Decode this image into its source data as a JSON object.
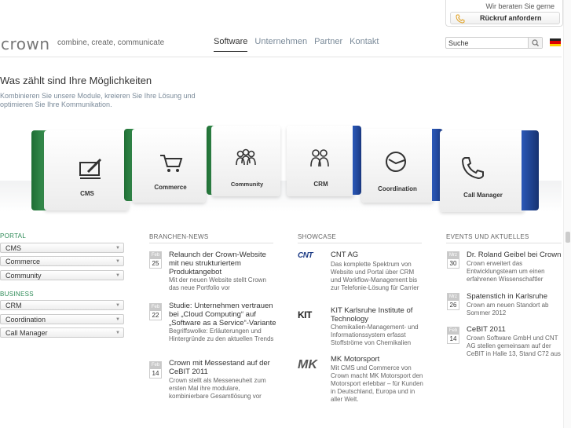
{
  "header": {
    "callback_note": "Wir beraten Sie gerne",
    "callback_label": "Rückruf anfordern",
    "logo": "crown",
    "tagline": "combine, create, communicate",
    "nav": [
      "Software",
      "Unternehmen",
      "Partner",
      "Kontakt"
    ],
    "search_value": "Suche"
  },
  "hero": {
    "title": "Was zählt sind Ihre Möglichkeiten",
    "intro": "Kombinieren Sie unsere Module, kreieren Sie Ihre Lösung und optimieren Sie Ihre Kommunikation.",
    "modules": [
      "CMS",
      "Commerce",
      "Community",
      "CRM",
      "Coordination",
      "Call Manager"
    ],
    "colors": {
      "green": "#2f8b4a",
      "blue": "#2a4ea0"
    }
  },
  "sidebar": {
    "portal_title": "PORTAL",
    "portal": [
      "CMS",
      "Commerce",
      "Community"
    ],
    "business_title": "BUSINESS",
    "business": [
      "CRM",
      "Coordination",
      "Call Manager"
    ]
  },
  "news": {
    "title": "BRANCHEN-NEWS",
    "items": [
      {
        "month": "Feb",
        "day": "25",
        "headline": "Relaunch der Crown-Website mit neu strukturiertem Produktangebot",
        "text": "Mit der neuen Website stellt Crown das neue Portfolio vor"
      },
      {
        "month": "Feb",
        "day": "22",
        "headline": "Studie: Unternehmen vertrauen bei „Cloud Computing“ auf „Software as a Service“-Variante",
        "text": "Begriffswolke: Erläuterungen und Hintergründe zu den aktuellen Trends"
      },
      {
        "month": "Feb",
        "day": "14",
        "headline": "Crown mit Messestand auf der CeBIT 2011",
        "text": "Crown stellt als Messeneuheit zum ersten Mal ihre modulare, kombinierbare Gesamtlösung vor"
      }
    ]
  },
  "showcase": {
    "title": "SHOWCASE",
    "items": [
      {
        "logo": "CNT",
        "headline": "CNT AG",
        "text": "Das komplette Spektrum von Website und Portal über CRM und Workflow-Management bis zur Telefonie-Lösung für Carrier"
      },
      {
        "logo": "KIT",
        "headline": "KIT Karlsruhe Institute of Technology",
        "text": "Chemikalien-Management- und Informationssystem erfasst Stoffströme von Chemikalien"
      },
      {
        "logo": "MK",
        "headline": "MK Motorsport",
        "text": "Mit CMS und Commerce von Crown macht MK Motorsport den Motorsport erlebbar – für Kunden in Deutschland, Europa und in aller Welt."
      }
    ]
  },
  "events": {
    "title": "EVENTS UND AKTUELLES",
    "items": [
      {
        "month": "Mrz",
        "day": "30",
        "headline": "Dr. Roland Geibel bei Crown",
        "text": "Crown erweitert das Entwicklungsteam um einen erfahrenen Wissenschaftler"
      },
      {
        "month": "Mrz",
        "day": "26",
        "headline": "Spatenstich in Karlsruhe",
        "text": "Crown am neuen Standort ab Sommer 2012"
      },
      {
        "month": "Feb",
        "day": "14",
        "headline": "CeBIT 2011",
        "text": "Crown Software GmbH und CNT AG stellen gemeinsam auf der CeBIT in Halle 13, Stand C72 aus"
      }
    ]
  }
}
